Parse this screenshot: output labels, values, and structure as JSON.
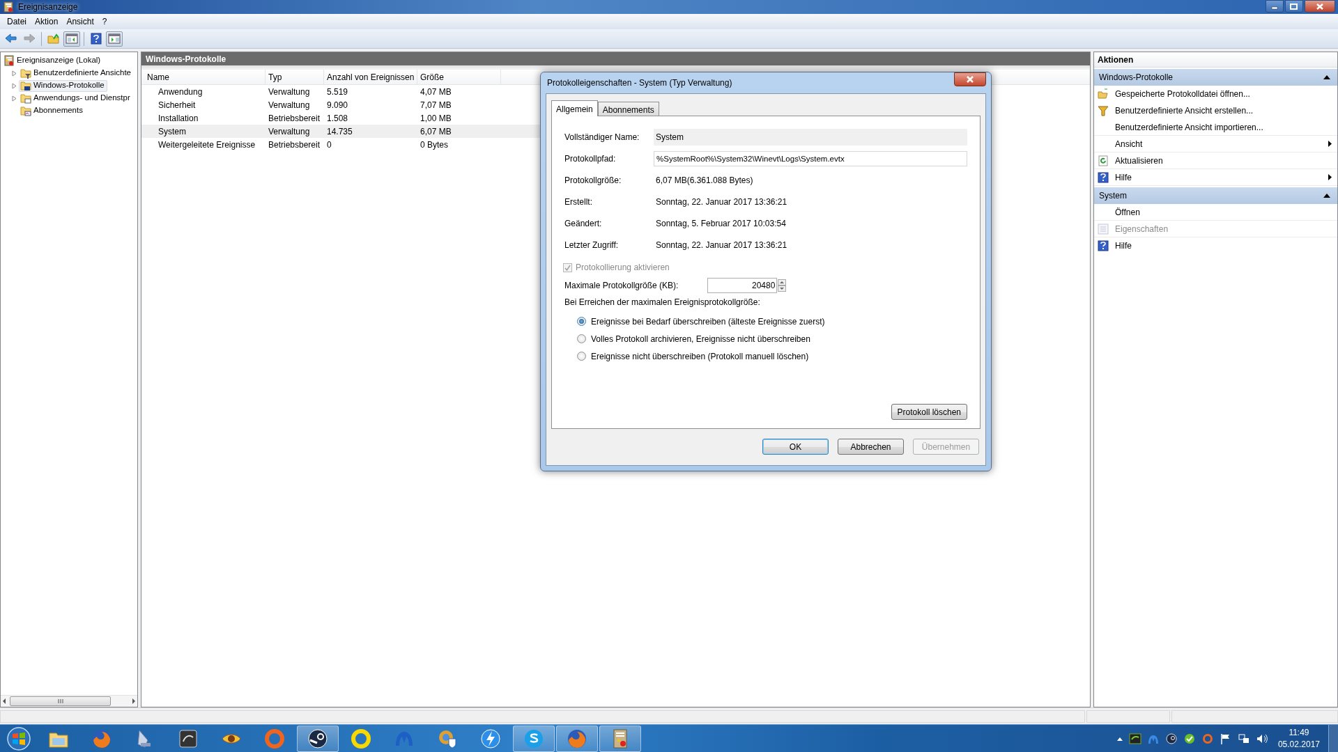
{
  "window": {
    "title": "Ereignisanzeige"
  },
  "menu": [
    "Datei",
    "Aktion",
    "Ansicht",
    "?"
  ],
  "toolbar": [
    {
      "kind": "back",
      "disabled": false,
      "pressed": false
    },
    {
      "kind": "forward",
      "disabled": true,
      "pressed": false
    },
    {
      "kind": "up",
      "disabled": false,
      "pressed": false
    },
    {
      "kind": "tree-pane",
      "disabled": false,
      "pressed": true
    },
    {
      "kind": "help",
      "disabled": false,
      "pressed": false
    },
    {
      "kind": "action-pane",
      "disabled": false,
      "pressed": true
    }
  ],
  "tree": [
    {
      "label": "Ereignisanzeige (Lokal)",
      "kind": "viewer",
      "selected": false,
      "children": [
        {
          "label": "Benutzerdefinierte Ansichte",
          "kind": "filter-folder",
          "selected": false,
          "expandable": true
        },
        {
          "label": "Windows-Protokolle",
          "kind": "log-folder",
          "selected": true,
          "expandable": true
        },
        {
          "label": "Anwendungs- und Dienstpr",
          "kind": "app-folder",
          "selected": false,
          "expandable": true
        },
        {
          "label": "Abonnements",
          "kind": "sub-folder",
          "selected": false,
          "expandable": false
        }
      ]
    }
  ],
  "center": {
    "title": "Windows-Protokolle",
    "columns": [
      "Name",
      "Typ",
      "Anzahl von Ereignissen",
      "Größe"
    ],
    "rows": [
      {
        "cells": [
          "Anwendung",
          "Verwaltung",
          "5.519",
          "4,07 MB"
        ],
        "selected": false
      },
      {
        "cells": [
          "Sicherheit",
          "Verwaltung",
          "9.090",
          "7,07 MB"
        ],
        "selected": false
      },
      {
        "cells": [
          "Installation",
          "Betriebsbereit",
          "1.508",
          "1,00 MB"
        ],
        "selected": false
      },
      {
        "cells": [
          "System",
          "Verwaltung",
          "14.735",
          "6,07 MB"
        ],
        "selected": true
      },
      {
        "cells": [
          "Weitergeleitete Ereignisse",
          "Betriebsbereit",
          "0",
          "0 Bytes"
        ],
        "selected": false
      }
    ]
  },
  "actions": {
    "title": "Aktionen",
    "sections": [
      {
        "title": "Windows-Protokolle",
        "expanded": true,
        "items": [
          {
            "label": "Gespeicherte Protokolldatei öffnen...",
            "kind": "open",
            "submenu": false,
            "disabled": false
          },
          {
            "label": "Benutzerdefinierte Ansicht erstellen...",
            "kind": "filter",
            "submenu": false,
            "disabled": false
          },
          {
            "label": "Benutzerdefinierte Ansicht importieren...",
            "kind": "plain",
            "submenu": false,
            "disabled": false
          },
          {
            "label": "Ansicht",
            "kind": "plain",
            "submenu": true,
            "disabled": false
          },
          {
            "label": "Aktualisieren",
            "kind": "refresh",
            "submenu": false,
            "disabled": false
          },
          {
            "label": "Hilfe",
            "kind": "help",
            "submenu": true,
            "disabled": false
          }
        ]
      },
      {
        "title": "System",
        "expanded": true,
        "items": [
          {
            "label": "Öffnen",
            "kind": "plain",
            "submenu": false,
            "disabled": false
          },
          {
            "label": "Eigenschaften",
            "kind": "properties",
            "submenu": false,
            "disabled": true
          },
          {
            "label": "Hilfe",
            "kind": "help",
            "submenu": false,
            "disabled": false
          }
        ]
      }
    ]
  },
  "dialog": {
    "title": "Protokolleigenschaften - System (Typ Verwaltung)",
    "tabs": [
      {
        "label": "Allgemein",
        "selected": true
      },
      {
        "label": "Abonnements",
        "selected": false
      }
    ],
    "fields": [
      {
        "label": "Vollständiger Name:",
        "value": "System",
        "kind": "readonly"
      },
      {
        "label": "Protokollpfad:",
        "value": "%SystemRoot%\\System32\\Winevt\\Logs\\System.evtx",
        "kind": "input"
      },
      {
        "label": "Protokollgröße:",
        "value": "6,07 MB(6.361.088 Bytes)",
        "kind": "text"
      },
      {
        "label": "Erstellt:",
        "value": "Sonntag, 22. Januar 2017 13:36:21",
        "kind": "text"
      },
      {
        "label": "Geändert:",
        "value": "Sonntag, 5. Februar 2017 10:03:54",
        "kind": "text"
      },
      {
        "label": "Letzter Zugriff:",
        "value": "Sonntag, 22. Januar 2017 13:36:21",
        "kind": "text"
      }
    ],
    "logging": {
      "label": "Protokollierung aktivieren",
      "checked": true,
      "disabled": true
    },
    "max_size": {
      "label": "Maximale Protokollgröße (KB):",
      "value": "20480"
    },
    "policy_label": "Bei Erreichen der maximalen Ereignisprotokollgröße:",
    "policies": [
      {
        "label": "Ereignisse bei Bedarf überschreiben (älteste Ereignisse zuerst)",
        "selected": true
      },
      {
        "label": "Volles Protokoll archivieren, Ereignisse nicht überschreiben",
        "selected": false
      },
      {
        "label": "Ereignisse nicht überschreiben (Protokoll manuell löschen)",
        "selected": false
      }
    ],
    "clear_button": "Protokoll löschen",
    "buttons": [
      {
        "label": "OK",
        "default": true,
        "disabled": false
      },
      {
        "label": "Abbrechen",
        "default": false,
        "disabled": false
      },
      {
        "label": "Übernehmen",
        "default": false,
        "disabled": true
      }
    ]
  },
  "taskbar": {
    "items": [
      {
        "kind": "explorer",
        "running": false
      },
      {
        "kind": "firefox",
        "running": false
      },
      {
        "kind": "scanner",
        "running": false
      },
      {
        "kind": "darktile",
        "running": false
      },
      {
        "kind": "eye",
        "running": false
      },
      {
        "kind": "origin",
        "running": false
      },
      {
        "kind": "steam",
        "running": true
      },
      {
        "kind": "yellowring",
        "running": false
      },
      {
        "kind": "mlogo",
        "running": false
      },
      {
        "kind": "shield",
        "running": false
      },
      {
        "kind": "bolt",
        "running": false
      },
      {
        "kind": "skype",
        "running": true
      },
      {
        "kind": "firefox",
        "running": true
      },
      {
        "kind": "viewer",
        "running": true
      }
    ],
    "time": "11:49",
    "date": "05.02.2017"
  }
}
